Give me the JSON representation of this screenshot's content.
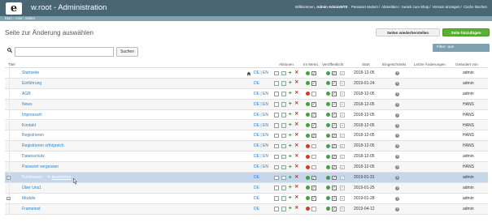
{
  "header": {
    "brand": "w.root - Administration",
    "welcome_prefix": "Willkommen, ",
    "user": "Admin AdminINTE",
    "links": [
      "Passwort ändern",
      "Abmelden",
      "zurück zum Shop",
      "Version anzeigen",
      "Cache löschen"
    ],
    "bg_color": "#4a6573"
  },
  "breadcrumbs": [
    "Start",
    "Cms",
    "Seiten"
  ],
  "page": {
    "title": "Seite zur Änderung auswählen",
    "restore_button": "Seiten wiederherstellen",
    "add_button": "Seite hinzufügen",
    "accent_color": "#5ab034"
  },
  "search": {
    "value": "",
    "placeholder": "",
    "button": "Suchen"
  },
  "filter": {
    "label": "Filter: aus"
  },
  "table": {
    "headers": {
      "title": "Titel",
      "actions": "Aktionen",
      "in_menu": "Im Menü",
      "published": "Veröffentlicht",
      "start": "Start",
      "restricted": "Eingeschränkt",
      "last_changes": "Letzte Änderungen",
      "changed_by": "Geändert von"
    },
    "rows": [
      {
        "title": "Startseite",
        "lang": "DE | EN",
        "home": true,
        "menu": "green",
        "start": "2018-12-05",
        "by": "admin"
      },
      {
        "title": "Einführung",
        "lang": "DE",
        "home": false,
        "menu": "green",
        "start": "2019-01-24",
        "by": "admin"
      },
      {
        "title": "AGB",
        "lang": "DE | EN",
        "home": false,
        "menu": "red",
        "start": "2018-12-05",
        "by": "admin"
      },
      {
        "title": "News",
        "lang": "DE | EN",
        "home": false,
        "menu": "green",
        "start": "2018-12-05",
        "by": "HANS"
      },
      {
        "title": "Impressum",
        "lang": "DE | EN",
        "home": false,
        "menu": "green",
        "start": "2018-12-05",
        "by": "HANS"
      },
      {
        "title": "Kontakt",
        "lang": "DE | EN",
        "home": false,
        "menu": "green",
        "start": "2018-12-05",
        "by": "HANS"
      },
      {
        "title": "Registrieren",
        "lang": "DE | EN",
        "home": false,
        "menu": "green",
        "start": "2018-12-05",
        "by": "HANS"
      },
      {
        "title": "Registrieren erfolgreich",
        "lang": "DE | EN",
        "home": false,
        "menu": "red",
        "start": "2018-12-05",
        "by": "HANS"
      },
      {
        "title": "Datenschutz",
        "lang": "DE | EN",
        "home": false,
        "menu": "red",
        "start": "2018-12-05",
        "by": "admin"
      },
      {
        "title": "Passwort vergessen",
        "lang": "DE | EN",
        "home": false,
        "menu": "red",
        "start": "2018-12-05",
        "by": "HANS"
      },
      {
        "title": "Funktionen",
        "lang": "DE",
        "home": false,
        "menu": "green",
        "start": "2019-01-31",
        "by": "admin",
        "highlight": true,
        "edit": "bearbeiten",
        "expander": true
      },
      {
        "title": "Über Uns1",
        "lang": "DE",
        "home": false,
        "menu": "green",
        "start": "2019-01-25",
        "by": "admin"
      },
      {
        "title": "Module",
        "lang": "DE",
        "home": false,
        "menu": "green",
        "start": "2019-01-28",
        "by": "admin",
        "expander": true
      },
      {
        "title": "Frametest",
        "lang": "DE",
        "home": false,
        "menu": "red",
        "start": "2019-04-12",
        "by": "admin"
      }
    ]
  }
}
